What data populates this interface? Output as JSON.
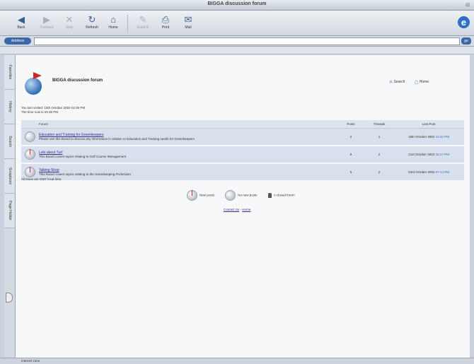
{
  "window": {
    "title": "BIGGA discussion forum"
  },
  "toolbar": {
    "buttons": [
      {
        "label": "Back",
        "icon": "back-arrow-icon"
      },
      {
        "label": "Forward",
        "icon": "forward-arrow-icon"
      },
      {
        "label": "Stop",
        "icon": "stop-icon"
      },
      {
        "label": "Refresh",
        "icon": "refresh-icon"
      },
      {
        "label": "Home",
        "icon": "home-icon"
      },
      {
        "label": "AutoFill",
        "icon": "autofill-icon"
      },
      {
        "label": "Print",
        "icon": "print-icon"
      },
      {
        "label": "Mail",
        "icon": "mail-icon"
      }
    ]
  },
  "addressbar": {
    "label": "Address",
    "value": "",
    "go_label": "go"
  },
  "sidebar": {
    "tabs": [
      "Favorites",
      "History",
      "Search",
      "Scrapbook",
      "Page Holder"
    ]
  },
  "page": {
    "forum_title": "BIGGA discussion forum",
    "links": {
      "search": "Search",
      "home": "Home"
    },
    "last_visited": "You last visited: 15th October 2002 02:35 PM",
    "time_now": "The time now is 04:35 PM.",
    "table": {
      "headers": {
        "forum": "Forum",
        "posts": "Posts",
        "threads": "Threads",
        "last_post": "Last Post"
      },
      "rows": [
        {
          "name": "Education and Training for Greenkeepers",
          "description": "Please use this Board to discuss any information in relation to Education and Training needs for Greenkeepers",
          "posts": "2",
          "threads": "1",
          "last_post_date": "16th October 2002",
          "last_post_time": "12:42 PM",
          "new": false
        },
        {
          "name": "Lets about Turf",
          "description": "This Board covers topics relating to Golf Course Management",
          "posts": "8",
          "threads": "2",
          "last_post_date": "21st October 2002",
          "last_post_time": "04:17 PM",
          "new": true
        },
        {
          "name": "Talking Shop",
          "description": "This Board covers topics relating to the Greenkeeping Profession",
          "posts": "5",
          "threads": "2",
          "last_post_date": "23rd October 2002",
          "last_post_time": "07:14 PM",
          "new": true
        }
      ]
    },
    "timezone_note": "All times are GMT local time.",
    "legend": {
      "new_posts": "New posts",
      "no_new_posts": "No new posts",
      "closed_forum": "A closed forum"
    },
    "footer": {
      "contact": "Contact Us",
      "separator": "-",
      "home": "Home"
    }
  },
  "statusbar": {
    "text": "Internet zone"
  }
}
